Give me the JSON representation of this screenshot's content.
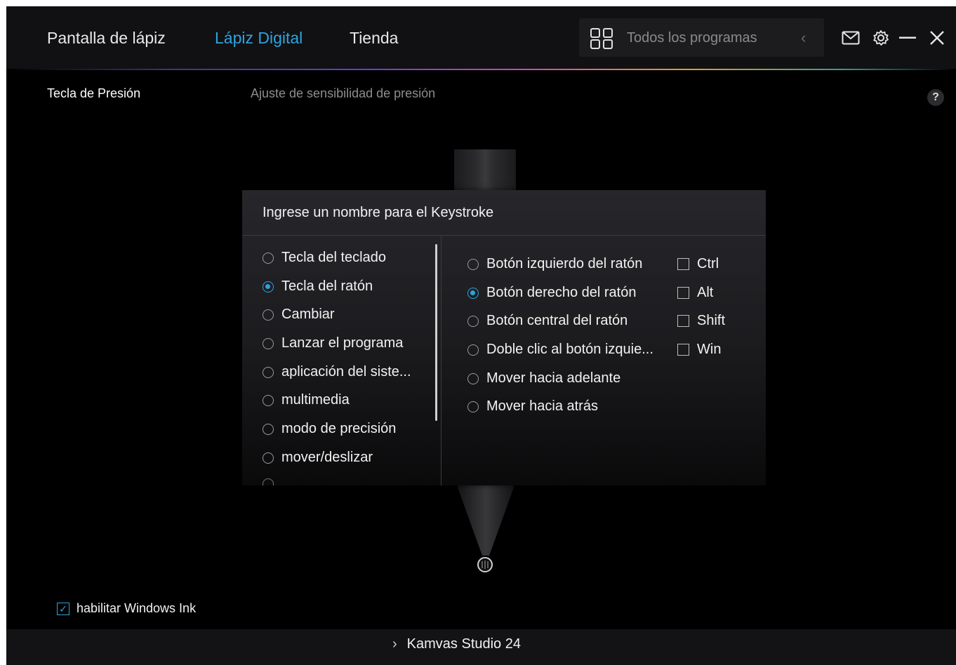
{
  "header": {
    "tabs": [
      {
        "label": "Pantalla de lápiz",
        "active": false
      },
      {
        "label": "Lápiz Digital",
        "active": true
      },
      {
        "label": "Tienda",
        "active": false
      }
    ],
    "programs_selector": {
      "label": "Todos los programas",
      "icon": "grid-icon",
      "collapse_icon": "chevron-left-icon"
    },
    "window_controls": [
      "mail-icon",
      "gear-icon",
      "minimize-icon",
      "close-icon"
    ]
  },
  "section": {
    "title": "Tecla de Presión",
    "subtitle": "Ajuste de sensibilidad de presión",
    "help_label": "?"
  },
  "dialog": {
    "title": "Ingrese un nombre para el Keystroke",
    "categories": [
      {
        "label": "Tecla del teclado",
        "selected": false
      },
      {
        "label": "Tecla del ratón",
        "selected": true
      },
      {
        "label": "Cambiar",
        "selected": false
      },
      {
        "label": "Lanzar el programa",
        "selected": false
      },
      {
        "label": "aplicación del siste...",
        "selected": false
      },
      {
        "label": "multimedia",
        "selected": false
      },
      {
        "label": "modo de precisión",
        "selected": false
      },
      {
        "label": "mover/deslizar",
        "selected": false
      }
    ],
    "mouse_actions": [
      {
        "label": "Botón izquierdo del ratón",
        "selected": false
      },
      {
        "label": "Botón derecho del ratón",
        "selected": true
      },
      {
        "label": "Botón central del ratón",
        "selected": false
      },
      {
        "label": "Doble clic al botón izquie...",
        "selected": false
      },
      {
        "label": "Mover hacia adelante",
        "selected": false
      },
      {
        "label": "Mover hacia atrás",
        "selected": false
      }
    ],
    "modifiers": [
      {
        "label": "Ctrl",
        "checked": false
      },
      {
        "label": "Alt",
        "checked": false
      },
      {
        "label": "Shift",
        "checked": false
      },
      {
        "label": "Win",
        "checked": false
      }
    ]
  },
  "windows_ink": {
    "label": "habilitar Windows Ink",
    "checked": true
  },
  "footer": {
    "device": "Kamvas Studio 24"
  },
  "colors": {
    "accent": "#2ea3df",
    "background": "#000000",
    "panel": "#1c1c1f"
  }
}
